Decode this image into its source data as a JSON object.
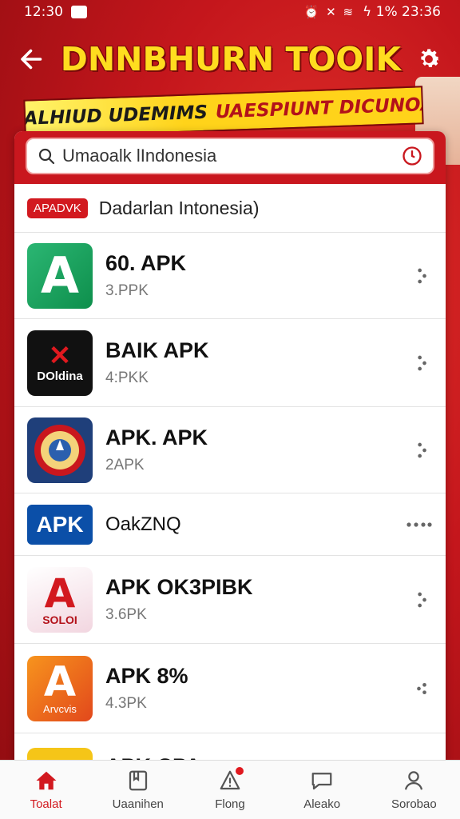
{
  "status_bar": {
    "time": "12:30",
    "battery_time": "ϟ 1% 23:36"
  },
  "header": {
    "title": "DNNBHURN TOOIK"
  },
  "banner": {
    "left": "NEALHIUD UDEMIMS",
    "right": "UAESPIUNT DICUNOA!!"
  },
  "search": {
    "value": "Umaoalk lIndonesia",
    "placeholder": "Umaoalk lIndonesia"
  },
  "section": {
    "badge": "APADVK",
    "title": "Dadarlan Intonesia)"
  },
  "apps": [
    {
      "name": "60. APK",
      "sub": "3.PPK",
      "icon_text": "A"
    },
    {
      "name": "BAIK APK",
      "sub": "4:PKK",
      "icon_text": "DOldina"
    },
    {
      "name": "APK. APK",
      "sub": "2APK",
      "icon_text": ""
    },
    {
      "name": "OakZNQ",
      "sub": "",
      "icon_text": "APK"
    },
    {
      "name": "APK OK3PIBK",
      "sub": "3.6PK",
      "icon_text": "SOLOI"
    },
    {
      "name": "APK 8%",
      "sub": "4.3PK",
      "icon_text": "Arvcvis"
    },
    {
      "name": "APK CPA",
      "sub": "",
      "icon_text": ""
    }
  ],
  "bottom_nav": [
    {
      "label": "Toalat",
      "icon": "home-icon",
      "active": true
    },
    {
      "label": "Uaanihen",
      "icon": "book-icon",
      "active": false
    },
    {
      "label": "Flong",
      "icon": "alert-icon",
      "active": false
    },
    {
      "label": "Aleako",
      "icon": "chat-icon",
      "active": false
    },
    {
      "label": "Sorobao",
      "icon": "person-icon",
      "active": false
    }
  ],
  "colors": {
    "brand_red": "#d2191f",
    "title_yellow": "#ffdd1f"
  }
}
